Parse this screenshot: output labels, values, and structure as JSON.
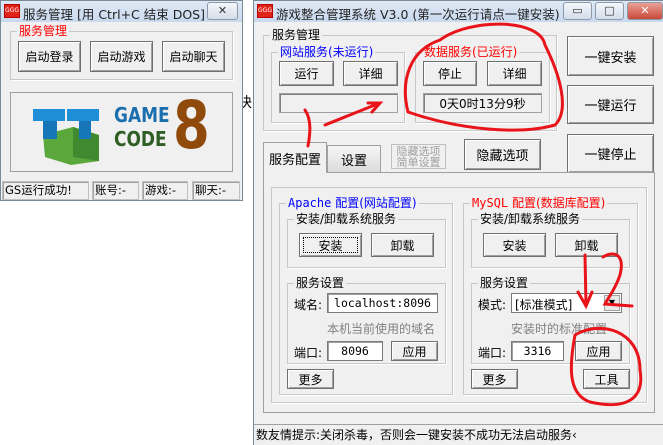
{
  "left_window": {
    "title": "服务管理 [用 Ctrl+C 结束 DOS]",
    "close_label": "✕",
    "group_label": "服务管理",
    "buttons": [
      "启动登录",
      "启动游戏",
      "启动聊天"
    ],
    "logo": {
      "line1": "GAME",
      "line2": "CODE",
      "number": "8"
    },
    "status": [
      "GS运行成功!",
      "账号:-",
      "游戏:-",
      "聊天:-"
    ]
  },
  "background_text": "块",
  "main_window": {
    "title": "游戏整合管理系统 V3.0 (第一次运行请点一键安装)",
    "controls": {
      "minimize": "▭",
      "maximize": "□",
      "close": "✕"
    },
    "service_group": "服务管理",
    "web_service": {
      "label": "网站服务(未运行)",
      "run": "运行",
      "detail": "详细",
      "status": ""
    },
    "data_service": {
      "label": "数据服务(已运行)",
      "stop": "停止",
      "detail": "详细",
      "uptime": "0天0时13分9秒"
    },
    "side_buttons": [
      "一键安装",
      "一键运行",
      "一键停止"
    ],
    "tabs": [
      "服务配置",
      "设置"
    ],
    "hidden_options_disabled": [
      "隐藏选项",
      "简单设置"
    ],
    "hide_options": "隐藏选项",
    "apache": {
      "label_en": "Apache",
      "label_cn": "配置(网站配置)",
      "install_group": "安装/卸载系统服务",
      "install": "安装",
      "uninstall": "卸载",
      "settings_group": "服务设置",
      "domain_label": "域名:",
      "domain_value": "localhost:8096",
      "domain_hint": "本机当前使用的域名",
      "port_label": "端口:",
      "port_value": "8096",
      "apply": "应用",
      "more": "更多"
    },
    "mysql": {
      "label_en": "MySQL",
      "label_cn": "配置(数据库配置)",
      "install_group": "安装/卸载系统服务",
      "install": "安装",
      "uninstall": "卸载",
      "settings_group": "服务设置",
      "mode_label": "模式:",
      "mode_value": "[标准模式]",
      "mode_hint": "安装时的标准配置",
      "port_label": "端口:",
      "port_value": "3316",
      "apply": "应用",
      "more": "更多",
      "tools": "工具"
    },
    "status_bar": "数友情提示:关闭杀毒，否则会一键安装不成功无法启动服务‹"
  },
  "colors": {
    "annotation": "#e8141a",
    "web_label": "#0000ff",
    "data_label": "#ff0000"
  }
}
